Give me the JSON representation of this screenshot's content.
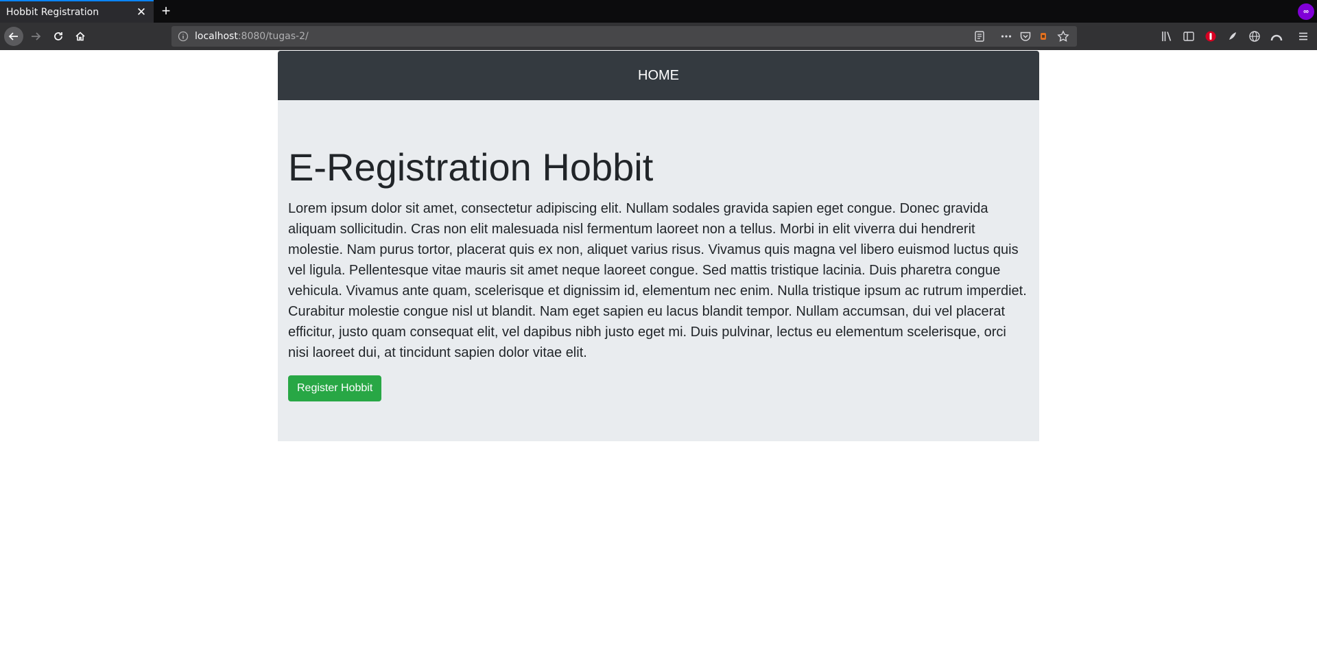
{
  "browser": {
    "tab_title": "Hobbit Registration",
    "tab_close": "✕",
    "new_tab": "+",
    "url_host": "localhost",
    "url_path": ":8080/tugas-2/"
  },
  "page": {
    "nav_link": "HOME",
    "title": "E-Registration Hobbit",
    "lead": "Lorem ipsum dolor sit amet, consectetur adipiscing elit. Nullam sodales gravida sapien eget congue. Donec gravida aliquam sollicitudin. Cras non elit malesuada nisl fermentum laoreet non a tellus. Morbi in elit viverra dui hendrerit molestie. Nam purus tortor, placerat quis ex non, aliquet varius risus. Vivamus quis magna vel libero euismod luctus quis vel ligula. Pellentesque vitae mauris sit amet neque laoreet congue. Sed mattis tristique lacinia. Duis pharetra congue vehicula. Vivamus ante quam, scelerisque et dignissim id, elementum nec enim. Nulla tristique ipsum ac rutrum imperdiet. Curabitur molestie congue nisl ut blandit. Nam eget sapien eu lacus blandit tempor. Nullam accumsan, dui vel placerat efficitur, justo quam consequat elit, vel dapibus nibh justo eget mi. Duis pulvinar, lectus eu elementum scelerisque, orci nisi laoreet dui, at tincidunt sapien dolor vitae elit.",
    "register_button": "Register Hobbit"
  },
  "colors": {
    "navbar_bg": "#343a40",
    "jumbotron_bg": "#e9ecef",
    "button_bg": "#28a745",
    "browser_accent": "#0a84ff"
  }
}
